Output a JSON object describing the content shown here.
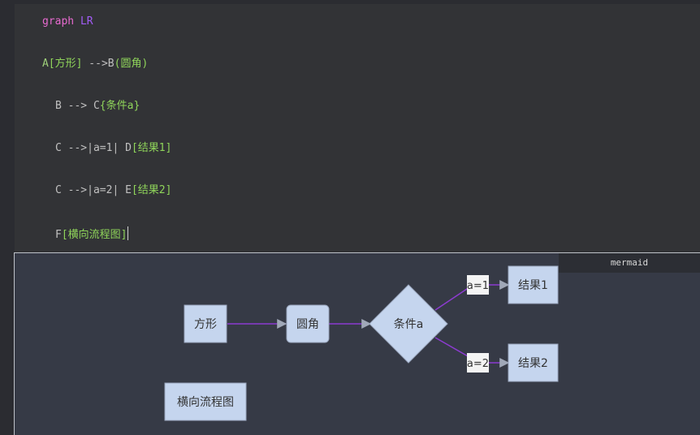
{
  "editor": {
    "lines": [
      {
        "kw": "graph",
        "dir": "LR"
      },
      {
        "id": "A",
        "tx": "[方形]",
        "op": " -->",
        "id2": "B",
        "tx2": "(圆角)"
      },
      {
        "id": "B",
        "op": " --> ",
        "id2": "C",
        "tx2": "{条件a}"
      },
      {
        "id": "C",
        "op": " -->|a=1| ",
        "id2": "D",
        "tx2": "[结果1]"
      },
      {
        "id": "C",
        "op": " -->|a=2| ",
        "id2": "E",
        "tx2": "[结果2]"
      },
      {
        "id": "F",
        "tx": "[横向流程图]"
      }
    ]
  },
  "preview": {
    "language_tag": "mermaid",
    "nodes": {
      "a": "方形",
      "b": "圆角",
      "c": "条件a",
      "d": "结果1",
      "e": "结果2",
      "f": "横向流程图"
    },
    "edge_labels": {
      "cd": "a=1",
      "ce": "a=2"
    }
  },
  "colors": {
    "node_fill": "#c5d5ee",
    "node_stroke": "#9aa6bd",
    "edge": "#8c3bd0",
    "arrowhead": "#a0a8b8"
  }
}
